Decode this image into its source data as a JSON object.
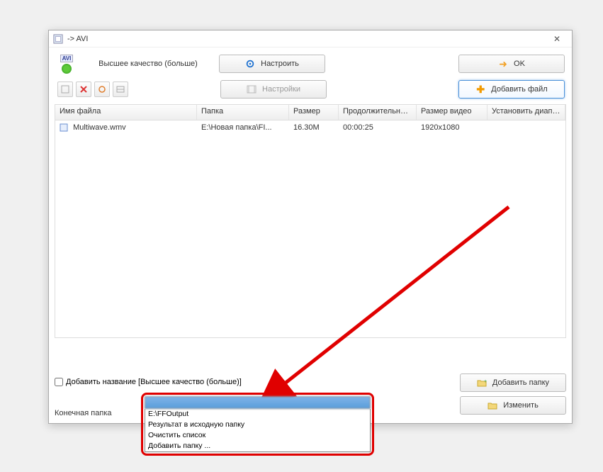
{
  "window": {
    "title": "-> AVI"
  },
  "toolbar": {
    "quality_label": "Высшее качество (больше)",
    "configure_label": "Настроить",
    "ok_label": "OK",
    "settings_label": "Настройки",
    "add_file_label": "Добавить файл"
  },
  "table": {
    "headers": {
      "name": "Имя файла",
      "folder": "Папка",
      "size": "Размер",
      "duration": "Продолжительность",
      "video_size": "Размер видео",
      "range": "Установить диапаз..."
    },
    "rows": [
      {
        "name": "Multiwave.wmv",
        "folder": "E:\\Новая папка\\FI...",
        "size": "16.30M",
        "duration": "00:00:25",
        "video_size": "1920x1080",
        "range": ""
      }
    ]
  },
  "bottom": {
    "add_title_checkbox_label": "Добавить название [Высшее качество (больше)]",
    "add_folder_label": "Добавить папку",
    "change_label": "Изменить",
    "dest_folder_label": "Конечная папка"
  },
  "dropdown": {
    "items": [
      "E:\\FFOutput",
      "Результат в исходную папку",
      "Очистить список",
      "Добавить папку ..."
    ]
  }
}
